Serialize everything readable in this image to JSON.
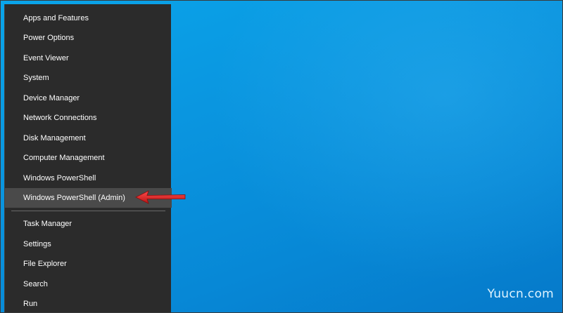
{
  "menu": {
    "items": [
      {
        "label": "Apps and Features"
      },
      {
        "label": "Power Options"
      },
      {
        "label": "Event Viewer"
      },
      {
        "label": "System"
      },
      {
        "label": "Device Manager"
      },
      {
        "label": "Network Connections"
      },
      {
        "label": "Disk Management"
      },
      {
        "label": "Computer Management"
      },
      {
        "label": "Windows PowerShell"
      },
      {
        "label": "Windows PowerShell (Admin)",
        "highlighted": true
      },
      {
        "label": "Task Manager"
      },
      {
        "label": "Settings"
      },
      {
        "label": "File Explorer"
      },
      {
        "label": "Search"
      },
      {
        "label": "Run"
      }
    ]
  },
  "annotation": {
    "arrow_color": "#e02020"
  },
  "watermark": {
    "text": "Yuucn.com"
  },
  "colors": {
    "desktop_blue": "#0a96e0",
    "menu_background": "#2b2b2b",
    "menu_highlight": "#4a4a4a",
    "menu_text": "#ffffff"
  }
}
